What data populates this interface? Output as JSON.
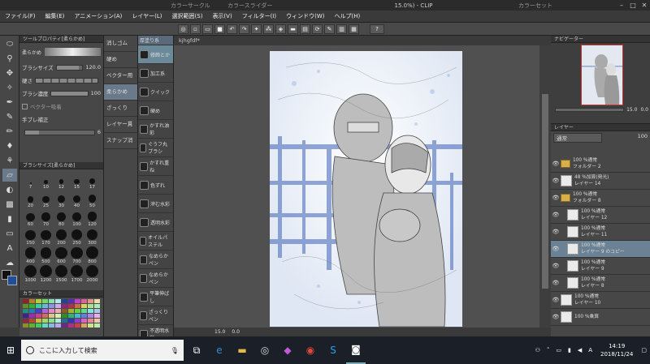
{
  "titlebar": {
    "panel_a": "カラーサークル",
    "panel_b": "カラースライダー",
    "doc": "15.0%) - CLIP",
    "panel_c": "カラーセット",
    "min": "–",
    "max": "□",
    "close": "✕"
  },
  "menu": [
    "ファイル(F)",
    "編集(E)",
    "アニメーション(A)",
    "レイヤー(L)",
    "選択範囲(S)",
    "表示(V)",
    "フィルター(I)",
    "ウィンドウ(W)",
    "ヘルプ(H)"
  ],
  "cmdbar": {
    "help": "?"
  },
  "tool_property": {
    "header": "ツールプロパティ[柔らかめ]",
    "tool_name": "柔らかめ",
    "brush_size_label": "ブラシサイズ",
    "brush_size_value": "120.0",
    "brush_size_fill": 0.85,
    "hardness_label": "硬さ",
    "density_label": "ブラシ濃度",
    "density_value": "100",
    "density_fill": 1.0,
    "pressure_label": "ベクター吸着",
    "stabilize_label": "手ブレ補正",
    "stabilize_value": "6",
    "stabilize_fill": 0.2
  },
  "brush_size_panel": {
    "header": "ブラシサイズ[柔らかめ]",
    "sizes": [
      "7",
      "10",
      "12",
      "15",
      "17",
      "20",
      "25",
      "30",
      "40",
      "50",
      "60",
      "70",
      "80",
      "100",
      "120",
      "150",
      "170",
      "200",
      "250",
      "300",
      "400",
      "500",
      "600",
      "700",
      "800",
      "1000",
      "1200",
      "1500",
      "1700",
      "2000"
    ]
  },
  "color_set": {
    "header": "カラーセット"
  },
  "subtool_groups": [
    "消しゴム",
    "硬め",
    "ベクター用",
    "柔らかめ",
    "ざっくり",
    "レイヤー貫",
    "スナップ消"
  ],
  "subtool_detail": {
    "tab": "厚塗り系",
    "items": [
      "修飾とか",
      "加工系",
      "クイック",
      "硬め",
      "かすれ油彩",
      "ぐうフ丸ブラシ",
      "かすれ重ね",
      "色ずれ",
      "滲む水彩",
      "透明水彩",
      "オイルパステル",
      "なめらかペン",
      "なめらかペン",
      "平筆伸ばし",
      "ざっくりペン",
      "不透明水彩"
    ]
  },
  "canvas": {
    "tab": "kjhgfdf*",
    "zoom": "15.0",
    "angle": "0.0"
  },
  "navigator": {
    "header": "ナビゲーター",
    "zoom": "15.0",
    "angle": "0.0"
  },
  "layer_panel": {
    "header": "レイヤー",
    "blend": "通常",
    "opacity": "100",
    "layers": [
      {
        "l1": "100 %通常",
        "l2": "フォルダー 2",
        "type": "folder",
        "sel": false
      },
      {
        "l1": "48 %加算(発光)",
        "l2": "レイヤー 14",
        "type": "layer",
        "sel": false
      },
      {
        "l1": "100 %通常",
        "l2": "フォルダー 8",
        "type": "folder",
        "sel": false
      },
      {
        "l1": "100 %通常",
        "l2": "レイヤー 12",
        "type": "layer",
        "sel": false
      },
      {
        "l1": "100 %通常",
        "l2": "レイヤー 11",
        "type": "layer",
        "sel": false
      },
      {
        "l1": "100 %通常",
        "l2": "レイヤー 9 のコピー",
        "type": "layer",
        "sel": true
      },
      {
        "l1": "100 %通常",
        "l2": "レイヤー 9",
        "type": "layer",
        "sel": false
      },
      {
        "l1": "100 %通常",
        "l2": "レイヤー 8",
        "type": "layer",
        "sel": false
      },
      {
        "l1": "100 %通常",
        "l2": "レイヤー 10",
        "type": "layer",
        "sel": false
      },
      {
        "l1": "100 %乗算",
        "l2": "",
        "type": "layer",
        "sel": false
      }
    ]
  },
  "taskbar": {
    "search_placeholder": "ここに入力して検索",
    "time": "14:19",
    "date": "2018/11/24",
    "ime": "A"
  }
}
